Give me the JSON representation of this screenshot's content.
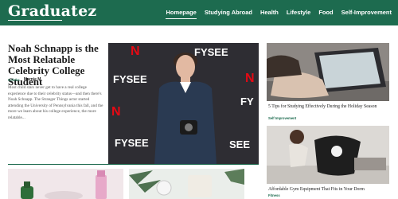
{
  "site": {
    "logo": "Graduatez"
  },
  "nav": {
    "items": [
      "Homepage",
      "Studying Abroad",
      "Health",
      "Lifestyle",
      "Food",
      "Self-Improvement"
    ],
    "active": "Homepage"
  },
  "hero": {
    "title": "Noah Schnapp is the Most Relatable Celebrity College Student",
    "category": "Celebs",
    "author": "Marnie M",
    "excerpt": "Most child stars never get to have a real college experience due to their celebrity status—and then there's Noah Schnapp. The Stranger Things actor started attending the University of Pennsylvania this fall, and the more we learn about his college experience, the more relatable...",
    "image_text": {
      "fysee": "FYSEE",
      "n": "N",
      "fy": "FY",
      "see": "SEE"
    }
  },
  "side_cards": [
    {
      "title": "5 Tips for Studying Effectively During the Holiday Season",
      "category": "Self Improvement"
    },
    {
      "title": "Affordable Gym Equipment That Fits in Your Dorm",
      "category": "Fitness"
    }
  ],
  "colors": {
    "brand": "#1d6b4f",
    "netflix_red": "#e50914"
  }
}
